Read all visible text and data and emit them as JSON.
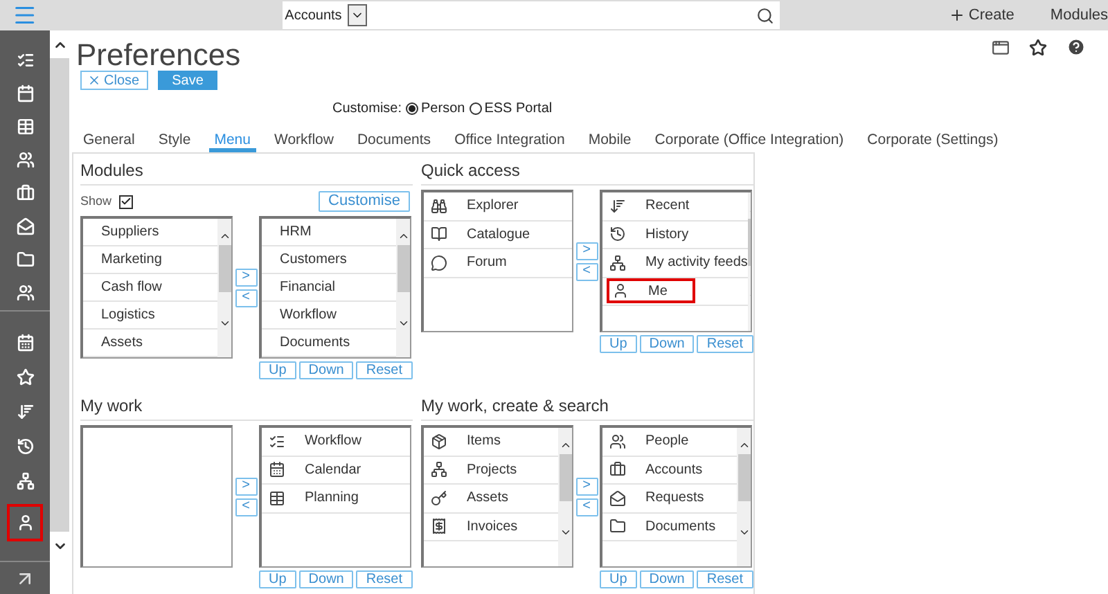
{
  "top_bar": {
    "search_scope": "Accounts",
    "create": "Create",
    "modules": "Modules"
  },
  "sidebar": {
    "groups": [
      {
        "items": [
          {
            "highlighted": false
          },
          {
            "highlighted": false
          },
          {
            "highlighted": false
          },
          {
            "highlighted": false
          },
          {
            "highlighted": false
          },
          {
            "highlighted": false
          },
          {
            "highlighted": false
          },
          {
            "highlighted": false
          }
        ]
      },
      {
        "items": [
          {
            "highlighted": false
          },
          {
            "highlighted": false
          },
          {
            "highlighted": false
          },
          {
            "highlighted": false
          },
          {
            "highlighted": false
          },
          {
            "highlighted": true
          }
        ]
      }
    ]
  },
  "page": {
    "title": "Preferences",
    "close": "Close",
    "save": "Save"
  },
  "customise": {
    "label": "Customise:",
    "options": [
      {
        "label": "Person",
        "selected": true
      },
      {
        "label": "ESS Portal",
        "selected": false
      }
    ]
  },
  "tabs": [
    {
      "label": "General",
      "selected": false
    },
    {
      "label": "Style",
      "selected": false
    },
    {
      "label": "Menu",
      "selected": true
    },
    {
      "label": "Workflow",
      "selected": false
    },
    {
      "label": "Documents",
      "selected": false
    },
    {
      "label": "Office Integration",
      "selected": false
    },
    {
      "label": "Mobile",
      "selected": false
    },
    {
      "label": "Corporate (Office Integration)",
      "selected": false
    },
    {
      "label": "Corporate (Settings)",
      "selected": false
    }
  ],
  "sections": [
    {
      "title": "Modules",
      "show": {
        "label": "Show",
        "checked": true
      },
      "customise_button": "Customise",
      "available": {
        "scrollbar": true,
        "items": [
          {
            "label": "Suppliers",
            "highlighted": false
          },
          {
            "label": "Marketing",
            "highlighted": false
          },
          {
            "label": "Cash flow",
            "highlighted": false
          },
          {
            "label": "Logistics",
            "highlighted": false
          },
          {
            "label": "Assets",
            "highlighted": false
          }
        ]
      },
      "move_buttons": [
        ">",
        "<"
      ],
      "chosen": {
        "scrollbar": true,
        "items": [
          {
            "label": "HRM",
            "highlighted": false
          },
          {
            "label": "Customers",
            "highlighted": false
          },
          {
            "label": "Financial",
            "highlighted": false
          },
          {
            "label": "Workflow",
            "highlighted": false
          },
          {
            "label": "Documents",
            "highlighted": false
          }
        ]
      },
      "order_buttons": [
        "Up",
        "Down",
        "Reset"
      ]
    },
    {
      "title": "Quick access",
      "available": {
        "scrollbar": false,
        "items": [
          {
            "label": "Explorer",
            "highlighted": false
          },
          {
            "label": "Catalogue",
            "highlighted": false
          },
          {
            "label": "Forum",
            "highlighted": false
          }
        ]
      },
      "move_buttons": [
        ">",
        "<"
      ],
      "chosen": {
        "scrollbar": true,
        "items": [
          {
            "label": "Recent",
            "highlighted": false
          },
          {
            "label": "History",
            "highlighted": false
          },
          {
            "label": "My activity feeds",
            "highlighted": false
          },
          {
            "label": "Me",
            "highlighted": true
          }
        ]
      },
      "order_buttons": [
        "Up",
        "Down",
        "Reset"
      ]
    },
    {
      "title": "My work",
      "available": {
        "scrollbar": false
      },
      "move_buttons": [
        ">",
        "<"
      ],
      "chosen": {
        "scrollbar": false,
        "items": [
          {
            "label": "Workflow",
            "highlighted": false
          },
          {
            "label": "Calendar",
            "highlighted": false
          },
          {
            "label": "Planning",
            "highlighted": false
          }
        ]
      },
      "order_buttons": [
        "Up",
        "Down",
        "Reset"
      ]
    },
    {
      "title": "My work, create & search",
      "available": {
        "scrollbar": true,
        "items": [
          {
            "label": "Items",
            "highlighted": false
          },
          {
            "label": "Projects",
            "highlighted": false
          },
          {
            "label": "Assets",
            "highlighted": false
          },
          {
            "label": "Invoices",
            "highlighted": false
          }
        ]
      },
      "move_buttons": [
        ">",
        "<"
      ],
      "chosen": {
        "scrollbar": true,
        "items": [
          {
            "label": "People",
            "highlighted": false
          },
          {
            "label": "Accounts",
            "highlighted": false
          },
          {
            "label": "Requests",
            "highlighted": false
          },
          {
            "label": "Documents",
            "highlighted": false
          }
        ]
      },
      "order_buttons": [
        "Up",
        "Down",
        "Reset"
      ]
    }
  ]
}
